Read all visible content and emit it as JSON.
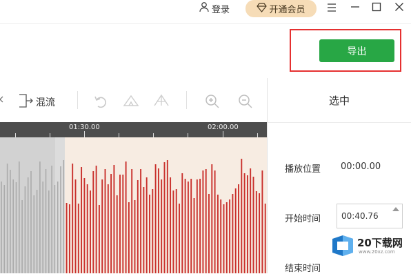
{
  "titlebar": {
    "login_label": "登录",
    "vip_label": "开通会员"
  },
  "toolbar": {
    "export_label": "导出",
    "mix_label": "混流"
  },
  "ruler": {
    "labels": [
      "01:30.00",
      "02:00.00"
    ]
  },
  "panel": {
    "title": "选中",
    "play_position_label": "播放位置",
    "play_position_value": "00:00.00",
    "start_time_label": "开始时间",
    "start_time_value": "00:40.76",
    "end_time_label": "结束时间"
  },
  "watermark": {
    "brand": "20下载网",
    "url": "www.20xz.com"
  },
  "colors": {
    "accent_green": "#28a745",
    "vip_bg": "#f6dcb7",
    "highlight_red": "#e53030",
    "waveform_red": "#c9302c",
    "waveform_gray": "#aaaaaa"
  }
}
